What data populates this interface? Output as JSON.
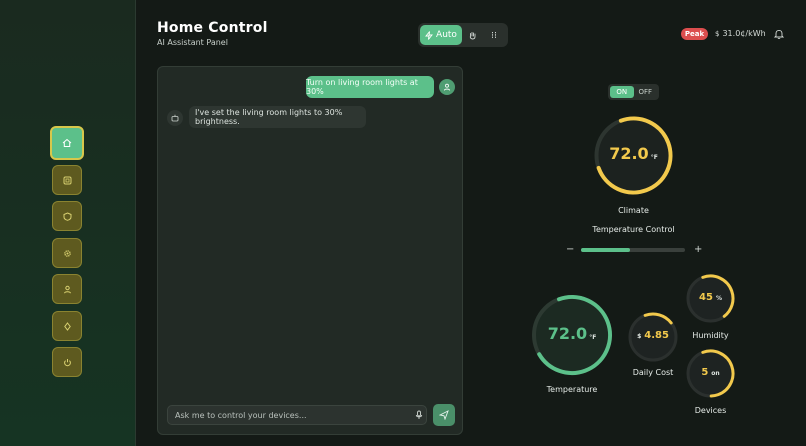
{
  "header": {
    "title": "Home Control",
    "subtitle": "AI Assistant Panel"
  },
  "modes": {
    "auto_label": "Auto",
    "manual_icon": "hand-icon",
    "schedule_icon": "sliders-icon"
  },
  "pricing": {
    "badge": "Peak",
    "currency": "$",
    "rate": "31.0¢/kWh"
  },
  "sidebar": {
    "items": [
      {
        "icon": "home-icon",
        "active": true
      },
      {
        "icon": "grid-icon",
        "active": false
      },
      {
        "icon": "shield-icon",
        "active": false
      },
      {
        "icon": "gear-icon",
        "active": false
      },
      {
        "icon": "user-icon",
        "active": false
      },
      {
        "icon": "bolt-icon",
        "active": false
      },
      {
        "icon": "power-icon",
        "active": false
      }
    ]
  },
  "chat": {
    "messages": [
      {
        "from": "user",
        "text": "Turn on living room lights at 30%"
      },
      {
        "from": "assistant",
        "text": "I've set the living room lights to 30% brightness."
      }
    ],
    "input_placeholder": "Ask me to control your devices..."
  },
  "climate": {
    "toggle_on": "ON",
    "toggle_off": "OFF",
    "state": "ON",
    "value": "72.0",
    "unit": "°F",
    "fill": 0.75,
    "label": "Climate",
    "control_label": "Temperature Control",
    "slider_minus": "−",
    "slider_plus": "+",
    "slider_level": 0.47
  },
  "stats": {
    "temperature": {
      "value": "72.0",
      "unit": "°F",
      "label": "Temperature",
      "fill": 0.72
    },
    "daily_cost": {
      "currency": "$",
      "value": "4.85",
      "label": "Daily Cost",
      "fill": 0.2
    },
    "humidity": {
      "value": "45",
      "unit": "%",
      "label": "Humidity",
      "fill": 0.45
    },
    "devices": {
      "value": "5",
      "unit": "on",
      "label": "Devices",
      "fill": 0.55
    }
  },
  "colors": {
    "accent": "#5cc08a",
    "gold": "#f2c94c",
    "danger": "#dc4e4e",
    "panel": "#222a25"
  }
}
